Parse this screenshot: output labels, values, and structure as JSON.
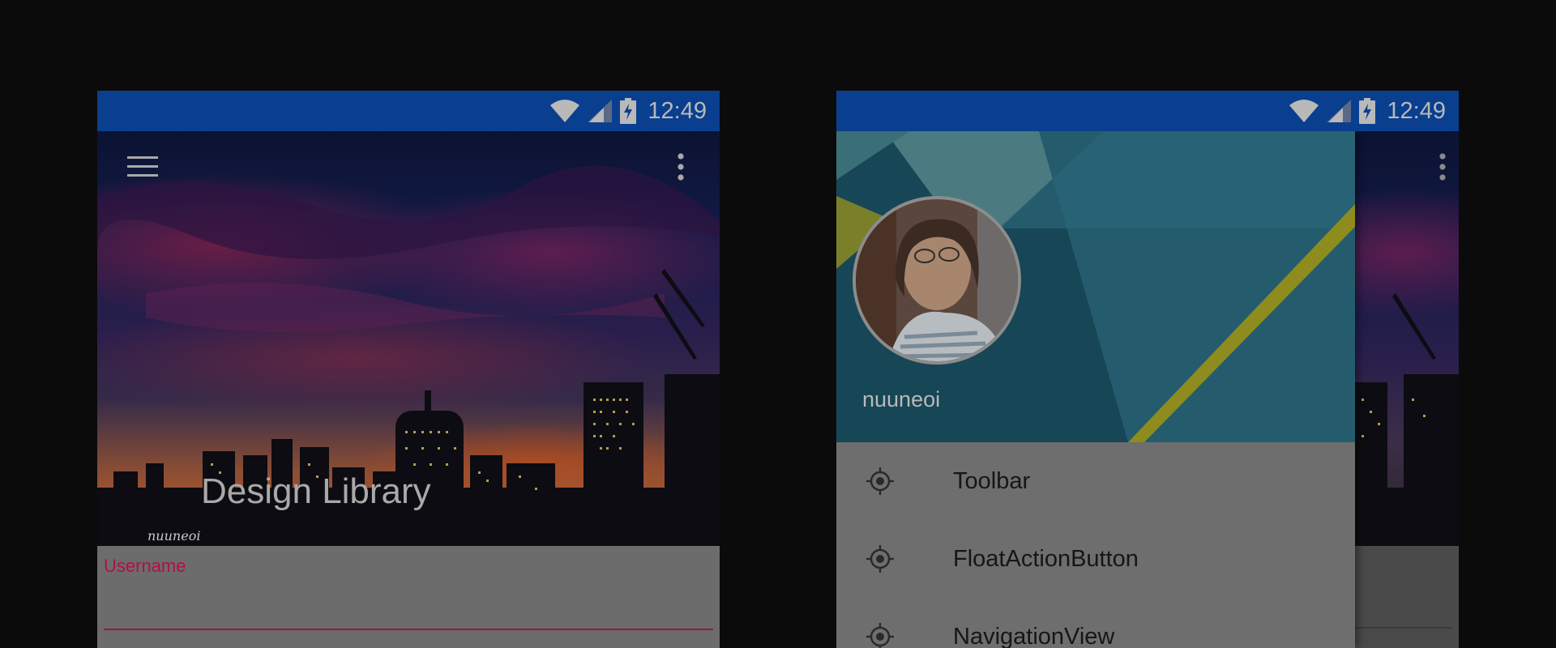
{
  "colors": {
    "status_bar": "#0a3f8f",
    "accent": "#b01048",
    "page_background": "#0b0b0b",
    "scrim_gray": "#6c6c6c"
  },
  "left_screen": {
    "status_bar": {
      "time": "12:49",
      "icons": [
        "wifi-icon",
        "cell-signal-icon",
        "battery-charging-icon"
      ]
    },
    "toolbar": {
      "menu_icon": "hamburger-menu-icon",
      "overflow_icon": "more-vert-icon"
    },
    "header": {
      "title": "Design Library",
      "photo_signature": "nuuneoi"
    },
    "form": {
      "username_label": "Username",
      "username_value": ""
    }
  },
  "right_screen": {
    "status_bar": {
      "time": "12:49",
      "icons": [
        "wifi-icon",
        "cell-signal-icon",
        "battery-charging-icon"
      ]
    },
    "drawer": {
      "username": "nuuneoi",
      "avatar": "profile-photo",
      "items": [
        {
          "label": "Toolbar",
          "icon": "gps-fixed-icon"
        },
        {
          "label": "FloatActionButton",
          "icon": "gps-fixed-icon"
        },
        {
          "label": "NavigationView",
          "icon": "gps-fixed-icon"
        }
      ]
    }
  }
}
